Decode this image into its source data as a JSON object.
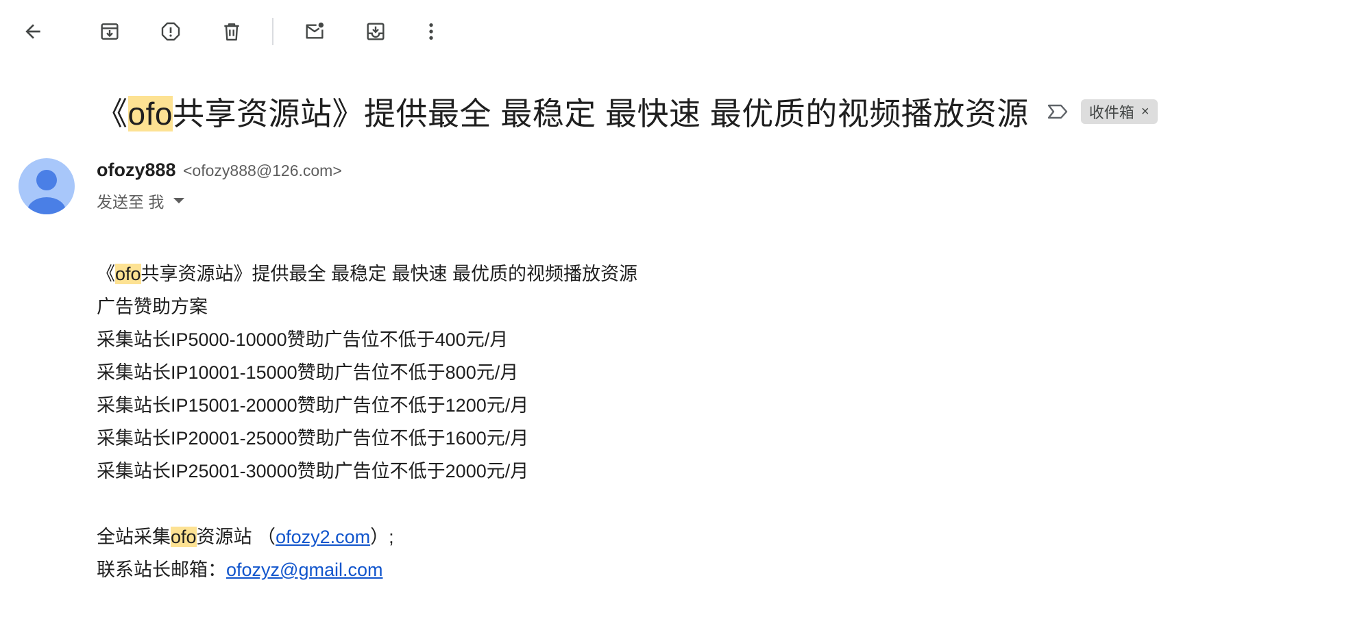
{
  "toolbar": {
    "buttons": [
      {
        "name": "back",
        "icon": "arrow-left-icon"
      },
      {
        "name": "archive",
        "icon": "archive-icon"
      },
      {
        "name": "report-spam",
        "icon": "report-spam-icon"
      },
      {
        "name": "delete",
        "icon": "trash-icon"
      },
      {
        "name": "mark-unread",
        "icon": "mail-unread-icon"
      },
      {
        "name": "move-to",
        "icon": "move-to-inbox-icon"
      },
      {
        "name": "more",
        "icon": "more-vert-icon"
      }
    ]
  },
  "message": {
    "subject": {
      "before": "《",
      "highlight": "ofo",
      "after": "共享资源站》提供最全 最稳定 最快速 最优质的视频播放资源"
    },
    "importance_icon": "importance-marker-icon",
    "label": "收件箱",
    "label_remove": "×",
    "sender": {
      "name": "ofozy888",
      "email": "<ofozy888@126.com>",
      "recipient": "发送至 我",
      "avatar_icon": "default-avatar-icon"
    },
    "body": {
      "line1": {
        "before": "《",
        "highlight": "ofo",
        "after": "共享资源站》提供最全 最稳定 最快速 最优质的视频播放资源"
      },
      "line2": "广告赞助方案",
      "line3": "采集站长IP5000-10000赞助广告位不低于400元/月",
      "line4": "采集站长IP10001-15000赞助广告位不低于800元/月",
      "line5": "采集站长IP15001-20000赞助广告位不低于1200元/月",
      "line6": "采集站长IP20001-25000赞助广告位不低于1600元/月",
      "line7": "采集站长IP25001-30000赞助广告位不低于2000元/月",
      "site_line": {
        "before": "全站采集",
        "highlight": "ofo",
        "after": "资源站 （",
        "link": "ofozy2.com",
        "end": "）;"
      },
      "contact_line": {
        "label": "联系站长邮箱：",
        "link": "ofozyz@gmail.com"
      }
    }
  },
  "colors": {
    "highlight": "#fde293",
    "link": "#1155cc",
    "avatar_bg": "#a8c7fa",
    "avatar_fg": "#4a7fe6",
    "label_chip_bg": "#dddddd",
    "icon": "#444746"
  }
}
